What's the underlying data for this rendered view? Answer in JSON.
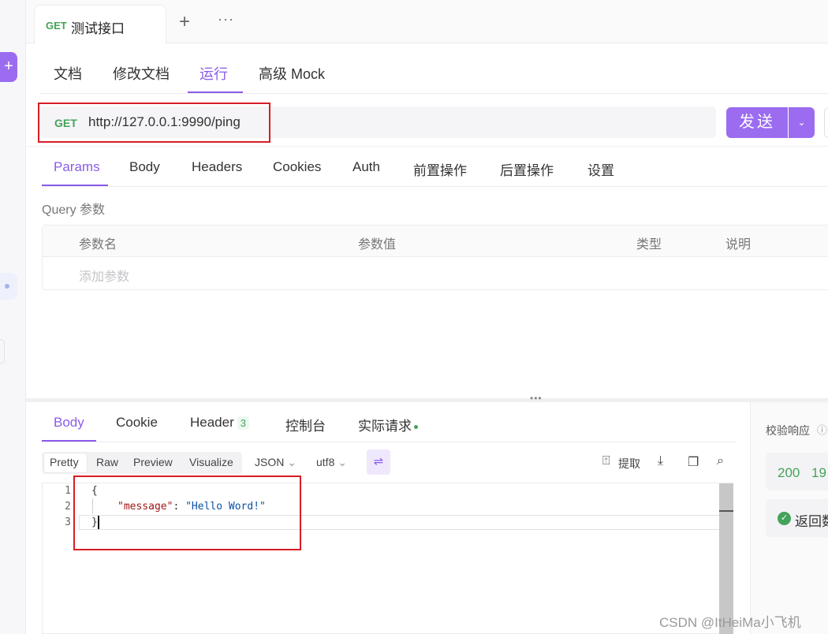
{
  "tab": {
    "method": "GET",
    "title": "测试接口",
    "add": "+",
    "more": "···"
  },
  "doc_tabs": [
    "文档",
    "修改文档",
    "运行",
    "高级 Mock"
  ],
  "request": {
    "method": "GET",
    "url": "http://127.0.0.1:9990/ping",
    "send_label": "发送",
    "send_drop": "⌄"
  },
  "param_tabs": [
    "Params",
    "Body",
    "Headers",
    "Cookies",
    "Auth",
    "前置操作",
    "后置操作",
    "设置"
  ],
  "query": {
    "label": "Query 参数",
    "columns": [
      "参数名",
      "参数值",
      "类型",
      "说明"
    ],
    "add_placeholder": "添加参数"
  },
  "response_tabs": {
    "body": "Body",
    "cookie": "Cookie",
    "header": "Header",
    "header_count": "3",
    "console": "控制台",
    "actual": "实际请求"
  },
  "view_modes": [
    "Pretty",
    "Raw",
    "Preview",
    "Visualize"
  ],
  "format": {
    "type": "JSON",
    "encoding": "utf8"
  },
  "tools": {
    "extract": "提取"
  },
  "code": {
    "line_numbers": [
      "1",
      "2",
      "3"
    ],
    "open": "{",
    "key": "\"message\"",
    "colon": ": ",
    "value": "\"Hello Word!\"",
    "close": "}"
  },
  "validate": {
    "label": "校验响应",
    "status": "200",
    "time": "19",
    "result": "返回数据"
  },
  "watermark": "CSDN @ItHeiMa小飞机",
  "colors": {
    "accent": "#8a5ce8",
    "button": "#9b6cf0",
    "success": "#44a35a",
    "highlight": "#d71d26"
  }
}
